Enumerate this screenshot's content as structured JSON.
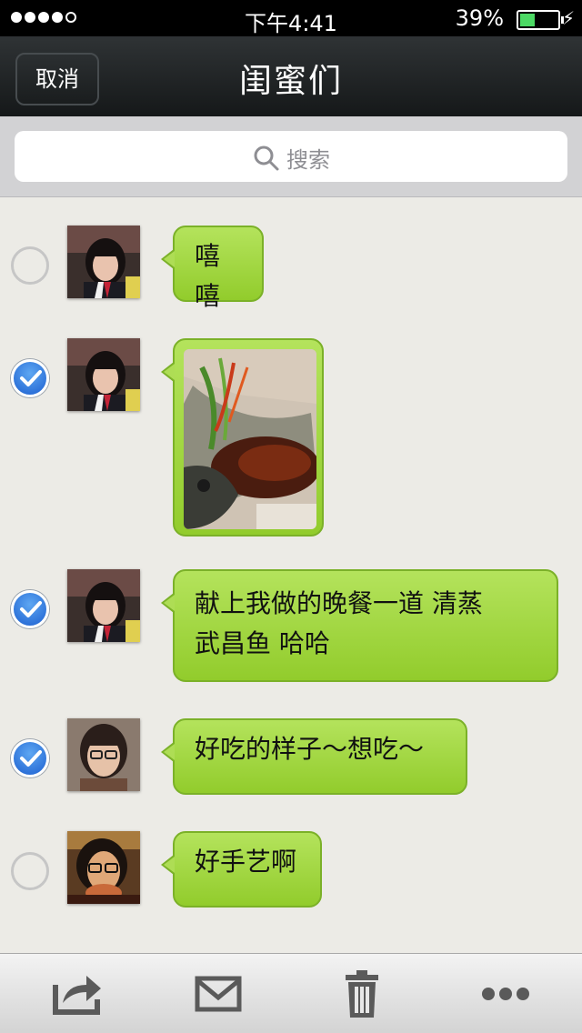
{
  "status_bar": {
    "time": "下午4:41",
    "battery": "39%",
    "battery_level": 0.39
  },
  "nav": {
    "cancel_label": "取消",
    "title": "闺蜜们"
  },
  "search": {
    "placeholder": "搜索"
  },
  "messages": [
    {
      "text": "嘻嘻",
      "selected": false
    },
    {
      "text": "",
      "type": "image",
      "selected": true
    },
    {
      "text": "献上我做的晚餐一道 清蒸武昌鱼 哈哈",
      "line1": "献上我做的晚餐一道 清蒸",
      "line2": "武昌鱼 哈哈",
      "selected": true
    },
    {
      "text": "好吃的样子～想吃～",
      "selected": true
    },
    {
      "text": "好手艺啊",
      "selected": false
    }
  ],
  "toolbar": {
    "icons": [
      "share-icon",
      "mail-icon",
      "trash-icon",
      "more-icon"
    ]
  },
  "colors": {
    "bubble": "#a6d944",
    "check_selected": "#2a72dc",
    "nav_bg": "#1f2325"
  }
}
